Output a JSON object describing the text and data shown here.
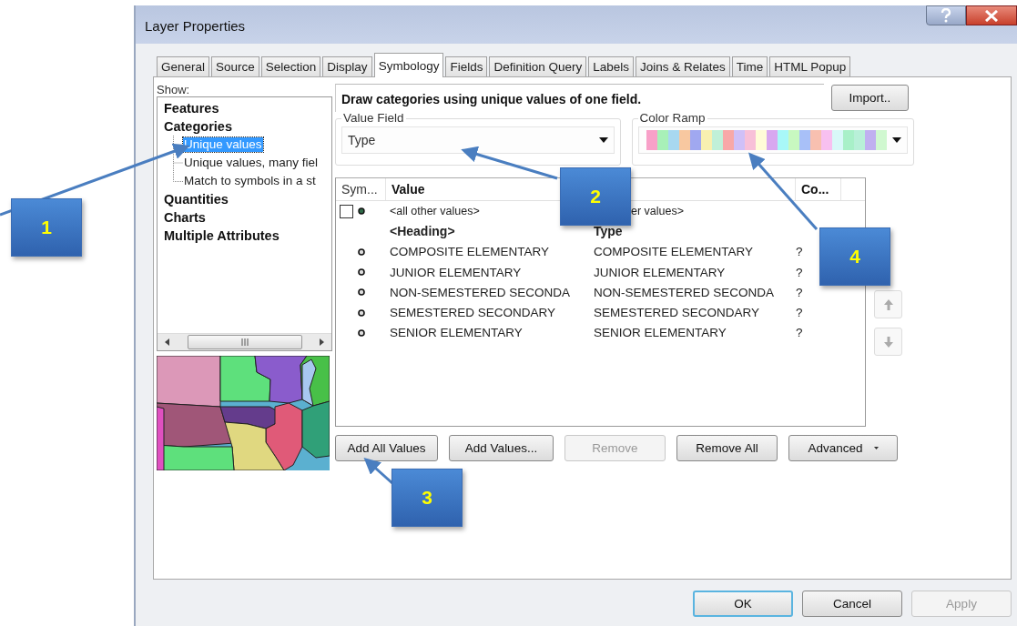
{
  "window": {
    "title": "Layer Properties"
  },
  "tabs": [
    {
      "label": "General",
      "selected": false
    },
    {
      "label": "Source",
      "selected": false
    },
    {
      "label": "Selection",
      "selected": false
    },
    {
      "label": "Display",
      "selected": false
    },
    {
      "label": "Symbology",
      "selected": true
    },
    {
      "label": "Fields",
      "selected": false
    },
    {
      "label": "Definition Query",
      "selected": false
    },
    {
      "label": "Labels",
      "selected": false
    },
    {
      "label": "Joins & Relates",
      "selected": false
    },
    {
      "label": "Time",
      "selected": false
    },
    {
      "label": "HTML Popup",
      "selected": false
    }
  ],
  "show": {
    "label": "Show:",
    "tree": [
      {
        "label": "Features",
        "selected": false
      },
      {
        "label": "Categories",
        "selected": false,
        "children": [
          {
            "label": "Unique values",
            "selected": true
          },
          {
            "label": "Unique values, many fiel",
            "selected": false
          },
          {
            "label": "Match to symbols in a st",
            "selected": false
          }
        ]
      },
      {
        "label": "Quantities",
        "selected": false
      },
      {
        "label": "Charts",
        "selected": false
      },
      {
        "label": "Multiple Attributes",
        "selected": false
      }
    ]
  },
  "description": "Draw categories using unique values of one field.",
  "import_button": "Import..",
  "value_field": {
    "legend": "Value Field",
    "value": "Type"
  },
  "color_ramp": {
    "legend": "Color Ramp"
  },
  "table": {
    "columns": [
      {
        "kind": "symbol",
        "label": "Sym..."
      },
      {
        "kind": "value",
        "label": "Value"
      },
      {
        "kind": "label"
      },
      {
        "kind": "count",
        "label": "Co..."
      }
    ],
    "rows": [
      {
        "kind": "other",
        "checked": false,
        "value": "<all other values>",
        "label": "er values>"
      },
      {
        "kind": "heading",
        "value": "<Heading>",
        "label": "Type"
      },
      {
        "kind": "value",
        "value": "COMPOSITE ELEMENTARY",
        "label": "COMPOSITE ELEMENTARY",
        "count": "?"
      },
      {
        "kind": "value",
        "value": "JUNIOR ELEMENTARY",
        "label": "JUNIOR ELEMENTARY",
        "count": "?"
      },
      {
        "kind": "value",
        "value": "NON-SEMESTERED SECONDA",
        "label": "NON-SEMESTERED SECONDA",
        "count": "?"
      },
      {
        "kind": "value",
        "value": "SEMESTERED SECONDARY",
        "label": "SEMESTERED SECONDARY",
        "count": "?"
      },
      {
        "kind": "value",
        "value": "SENIOR ELEMENTARY",
        "label": "SENIOR ELEMENTARY",
        "count": "?"
      }
    ]
  },
  "actions": [
    {
      "label": "Add All Values",
      "disabled": false,
      "kind": "plain"
    },
    {
      "label": "Add Values...",
      "disabled": false,
      "kind": "plain"
    },
    {
      "label": "Remove",
      "disabled": true,
      "kind": "plain"
    },
    {
      "label": "Remove All",
      "disabled": false,
      "kind": "plain"
    },
    {
      "label": "Advanced",
      "disabled": false,
      "kind": "menu"
    }
  ],
  "footer": [
    {
      "label": "OK",
      "disabled": false,
      "default": true
    },
    {
      "label": "Cancel",
      "disabled": false,
      "default": false
    },
    {
      "label": "Apply",
      "disabled": true,
      "default": false
    }
  ],
  "callouts": [
    {
      "number": "1"
    },
    {
      "number": "2"
    },
    {
      "number": "3"
    },
    {
      "number": "4"
    }
  ]
}
